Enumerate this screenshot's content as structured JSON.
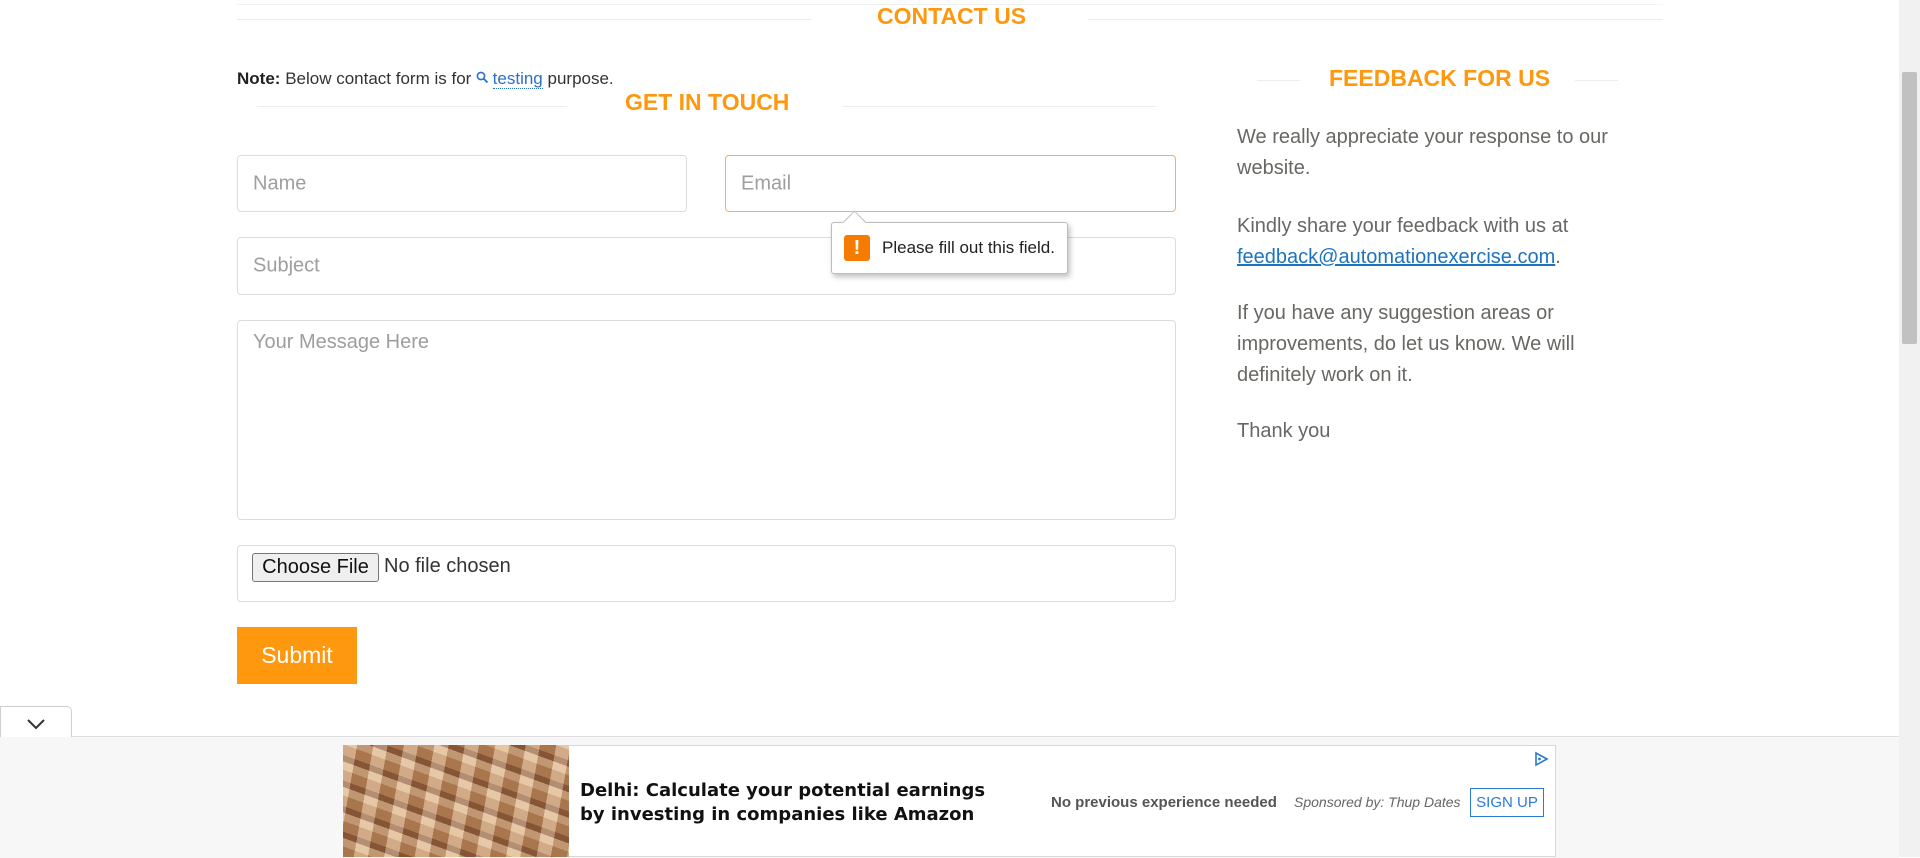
{
  "header": {
    "title": "CONTACT US"
  },
  "note": {
    "label": "Note:",
    "text_before": "Below contact form is for",
    "link": "testing",
    "text_after": "purpose."
  },
  "form": {
    "title": "GET IN TOUCH",
    "name_placeholder": "Name",
    "email_placeholder": "Email",
    "subject_placeholder": "Subject",
    "message_placeholder": "Your Message Here",
    "file_button": "Choose File",
    "file_status": "No file chosen",
    "submit_label": "Submit",
    "validation_message": "Please fill out this field."
  },
  "feedback": {
    "title": "FEEDBACK FOR US",
    "para1": "We really appreciate your response to our website.",
    "para2_before": "Kindly share your feedback with us at",
    "email": "feedback@automationexercise.com",
    "para2_after": ".",
    "para3": "If you have any suggestion areas or improvements, do let us know. We will definitely work on it.",
    "para4": "Thank you"
  },
  "ad": {
    "headline": "Delhi: Calculate your potential earnings by investing in companies like Amazon",
    "subtext": "No previous experience needed",
    "sponsor": "Sponsored by: Thup Dates",
    "cta": "SIGN UP"
  },
  "colors": {
    "accent": "#FE980F",
    "link": "#1e73be",
    "warning": "#f57c00"
  },
  "icons": {
    "note_link": "search-icon",
    "tooltip": "warning-icon",
    "collapse": "chevron-down-icon",
    "ad": "ad-choices-icon"
  }
}
